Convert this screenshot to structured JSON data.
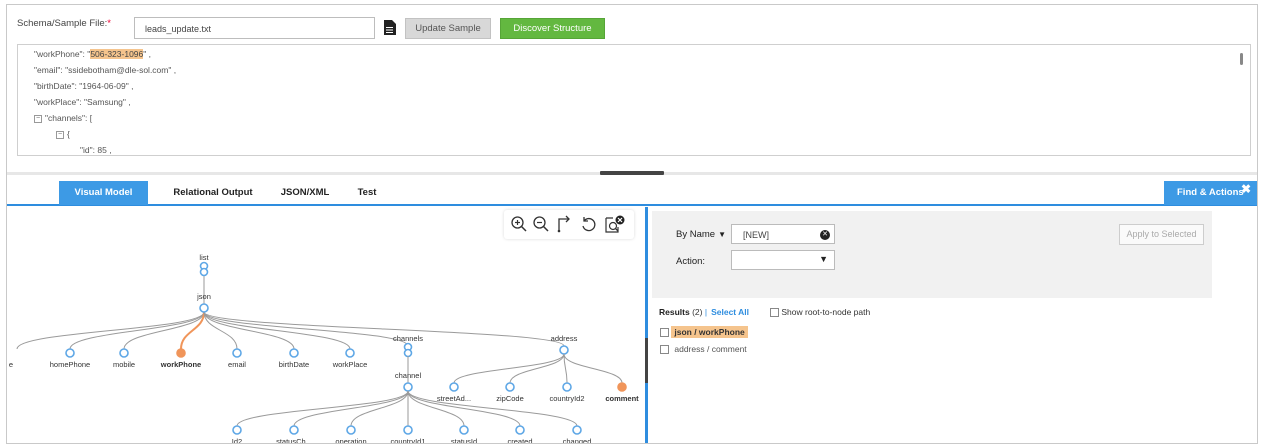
{
  "schema": {
    "label": "Schema/Sample File:",
    "required_mark": "*",
    "file_name": "leads_update.txt",
    "update_button": "Update Sample",
    "discover_button": "Discover Structure"
  },
  "code_lines": {
    "workPhone_key": "\"workPhone\": \"",
    "workPhone_value": "506-323-1096",
    "workPhone_end": "\" ,",
    "email": "\"email\": \"ssidebotham@dle-sol.com\" ,",
    "birthDate": "\"birthDate\": \"1964-06-09\" ,",
    "workPlace": "\"workPlace\": \"Samsung\" ,",
    "channels": "\"channels\": [",
    "brace": "{",
    "id": "\"id\": 85 ,"
  },
  "tabs": [
    "Visual Model",
    "Relational Output",
    "JSON/XML",
    "Test"
  ],
  "find_actions": {
    "label": "Find & Actions",
    "by_name": "By Name",
    "name_value": "[NEW]",
    "action_label": "Action:",
    "apply_button": "Apply to Selected"
  },
  "results": {
    "label": "Results",
    "count": "(2)",
    "separator": "|",
    "select_all": "Select All",
    "show_path": "Show root-to-node path",
    "items": [
      "json / workPhone",
      "address / comment"
    ]
  },
  "graph": {
    "root": "list",
    "json": "json",
    "children": [
      "e",
      "homePhone",
      "mobile",
      "workPhone",
      "email",
      "birthDate",
      "workPlace",
      "channels",
      "address"
    ],
    "channel": "channel",
    "channel_children": [
      "Id2",
      "statusCh...",
      "operation",
      "countryId1",
      "statusId",
      "created",
      "changed"
    ],
    "address_children": [
      "streetAd...",
      "zipCode",
      "countryId2",
      "comment"
    ]
  },
  "colors": {
    "accent": "#3d9ae5",
    "highlight": "#f5c48d",
    "discover": "#63b840",
    "node": "#5ea7e6",
    "node_selected": "#f0955a"
  }
}
